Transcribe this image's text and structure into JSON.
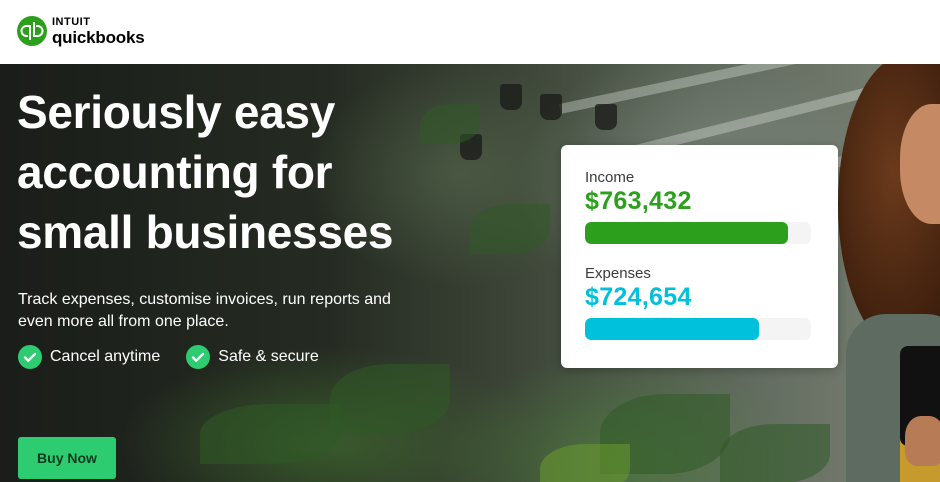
{
  "header": {
    "logo_intuit": "INTUIT",
    "logo_product": "quickbooks"
  },
  "hero": {
    "headline_lines": [
      "Seriously easy",
      "accounting for",
      "small businesses"
    ],
    "subtext_line1": "Track expenses, customise invoices, run reports and",
    "subtext_line2": "even more all from one place.",
    "features": [
      {
        "label": "Cancel anytime",
        "icon": "check-circle-icon"
      },
      {
        "label": "Safe & secure",
        "icon": "check-circle-icon"
      }
    ],
    "cta_label": "Buy Now"
  },
  "card": {
    "income": {
      "label": "Income",
      "value": "$763,432",
      "fill_fraction": 0.9
    },
    "expenses": {
      "label": "Expenses",
      "value": "$724,654",
      "fill_fraction": 0.77
    }
  },
  "colors": {
    "brand_green": "#2ca01c",
    "accent_green": "#2ecc71",
    "income_color": "#2ca01c",
    "expenses_color": "#00c1dc"
  }
}
